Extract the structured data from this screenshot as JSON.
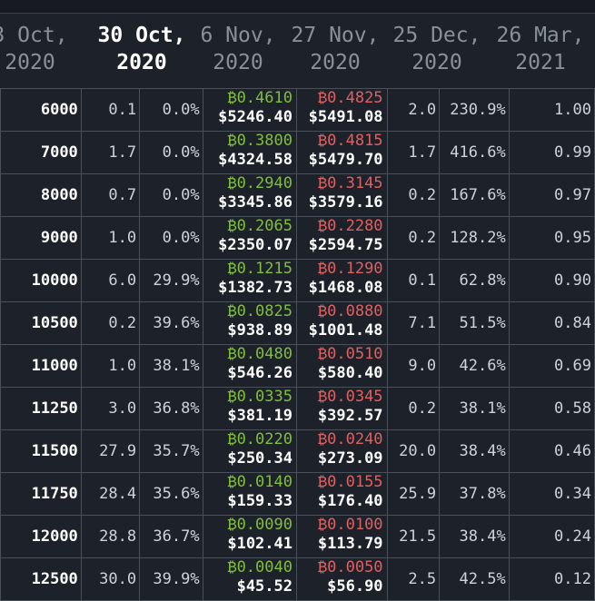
{
  "tabs": [
    {
      "l1": "3 Oct,",
      "l2": "2020"
    },
    {
      "l1": "30 Oct,",
      "l2": "2020"
    },
    {
      "l1": "6 Nov,",
      "l2": "2020"
    },
    {
      "l1": "27 Nov,",
      "l2": "2020"
    },
    {
      "l1": "25 Dec,",
      "l2": "2020"
    },
    {
      "l1": "26 Mar,",
      "l2": "2021"
    }
  ],
  "rows": [
    {
      "strike": "6000",
      "size": "0.1",
      "pct": "0.0%",
      "bid_btc": "₿0.4610",
      "bid_usd": "$5246.40",
      "ask_btc": "₿0.4825",
      "ask_usd": "$5491.08",
      "vol": "2.0",
      "iv": "230.9%",
      "delta": "1.00"
    },
    {
      "strike": "7000",
      "size": "1.7",
      "pct": "0.0%",
      "bid_btc": "₿0.3800",
      "bid_usd": "$4324.58",
      "ask_btc": "₿0.4815",
      "ask_usd": "$5479.70",
      "vol": "1.7",
      "iv": "416.6%",
      "delta": "0.99"
    },
    {
      "strike": "8000",
      "size": "0.7",
      "pct": "0.0%",
      "bid_btc": "₿0.2940",
      "bid_usd": "$3345.86",
      "ask_btc": "₿0.3145",
      "ask_usd": "$3579.16",
      "vol": "0.2",
      "iv": "167.6%",
      "delta": "0.97"
    },
    {
      "strike": "9000",
      "size": "1.0",
      "pct": "0.0%",
      "bid_btc": "₿0.2065",
      "bid_usd": "$2350.07",
      "ask_btc": "₿0.2280",
      "ask_usd": "$2594.75",
      "vol": "0.2",
      "iv": "128.2%",
      "delta": "0.95"
    },
    {
      "strike": "10000",
      "size": "6.0",
      "pct": "29.9%",
      "bid_btc": "₿0.1215",
      "bid_usd": "$1382.73",
      "ask_btc": "₿0.1290",
      "ask_usd": "$1468.08",
      "vol": "0.1",
      "iv": "62.8%",
      "delta": "0.90"
    },
    {
      "strike": "10500",
      "size": "0.2",
      "pct": "39.6%",
      "bid_btc": "₿0.0825",
      "bid_usd": "$938.89",
      "ask_btc": "₿0.0880",
      "ask_usd": "$1001.48",
      "vol": "7.1",
      "iv": "51.5%",
      "delta": "0.84"
    },
    {
      "strike": "11000",
      "size": "1.0",
      "pct": "38.1%",
      "bid_btc": "₿0.0480",
      "bid_usd": "$546.26",
      "ask_btc": "₿0.0510",
      "ask_usd": "$580.40",
      "vol": "9.0",
      "iv": "42.6%",
      "delta": "0.69"
    },
    {
      "strike": "11250",
      "size": "3.0",
      "pct": "36.8%",
      "bid_btc": "₿0.0335",
      "bid_usd": "$381.19",
      "ask_btc": "₿0.0345",
      "ask_usd": "$392.57",
      "vol": "0.2",
      "iv": "38.1%",
      "delta": "0.58"
    },
    {
      "strike": "11500",
      "size": "27.9",
      "pct": "35.7%",
      "bid_btc": "₿0.0220",
      "bid_usd": "$250.34",
      "ask_btc": "₿0.0240",
      "ask_usd": "$273.09",
      "vol": "20.0",
      "iv": "38.4%",
      "delta": "0.46"
    },
    {
      "strike": "11750",
      "size": "28.4",
      "pct": "35.6%",
      "bid_btc": "₿0.0140",
      "bid_usd": "$159.33",
      "ask_btc": "₿0.0155",
      "ask_usd": "$176.40",
      "vol": "25.9",
      "iv": "37.8%",
      "delta": "0.34"
    },
    {
      "strike": "12000",
      "size": "28.8",
      "pct": "36.7%",
      "bid_btc": "₿0.0090",
      "bid_usd": "$102.41",
      "ask_btc": "₿0.0100",
      "ask_usd": "$113.79",
      "vol": "21.5",
      "iv": "38.4%",
      "delta": "0.24"
    },
    {
      "strike": "12500",
      "size": "30.0",
      "pct": "39.9%",
      "bid_btc": "₿0.0040",
      "bid_usd": "$45.52",
      "ask_btc": "₿0.0050",
      "ask_usd": "$56.90",
      "vol": "2.5",
      "iv": "42.5%",
      "delta": "0.12"
    }
  ],
  "colors": {
    "bid": "#7fbf3a",
    "ask": "#e06060",
    "accent": "#3fa89a"
  }
}
